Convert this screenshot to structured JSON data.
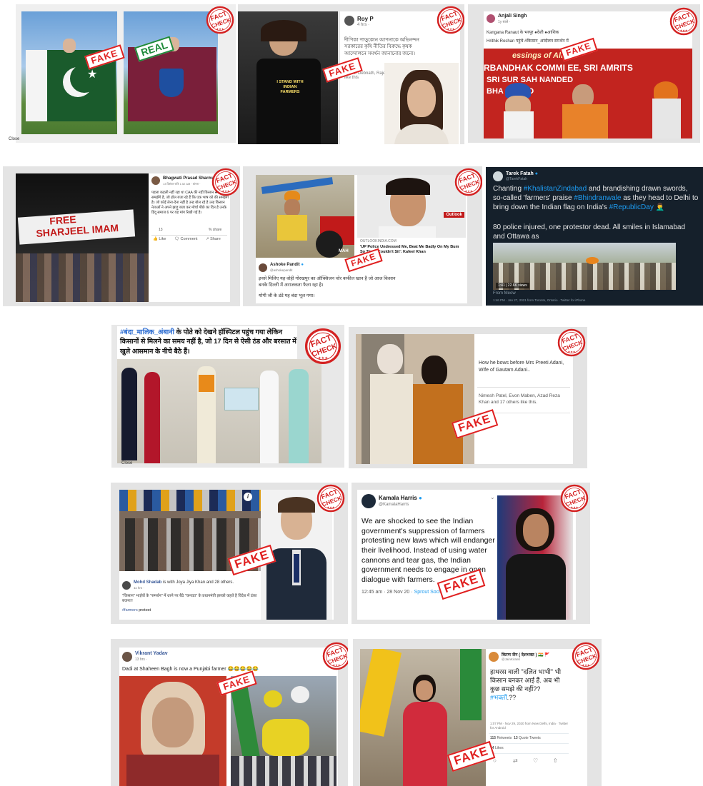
{
  "stamps": {
    "fake": "FAKE",
    "real": "REAL",
    "fact": "FACT",
    "check": "CHECK"
  },
  "row1": {
    "c1": {
      "close": "Close"
    },
    "c2": {
      "name": "Roy P",
      "time": "4 hrs · ",
      "text": "দীপিকা পাড়ুকোন আপনাকে অভিনন্দন সরকারের কৃষি নীতির বিরুদ্ধে কৃষক আন্দোলনে সমর্থন জানানোর জন্যে।",
      "likes": "Sudhir Debnath, Rajeshwar … and 3 others like this",
      "likes2": "Lal and 3 others like this",
      "tshirt": "I STAND WITH INDIAN FARMERS"
    },
    "c3": {
      "name": "Anjali Singh",
      "time": "1y बाले · ",
      "l1": "Kangana Ranaut के भरपूर ●देशी ●आशिक",
      "l2": "Hrithik Roshan पहुंचे #किसान_आंदोलन समर्थन में",
      "banner": "essings of Almi",
      "banner2": "RBANDHAK COMMI EE, SRI AMRITS",
      "banner3": "SRI SUR SAH NANDED",
      "banner4": "BHA (RE.), D"
    }
  },
  "row2": {
    "c1": {
      "name": "Bhagwati Prasad Sharma",
      "time": "13 दिसंबर रात्रि 1:52 AM · बांग्ला · ",
      "text": "पहला कहली नहीं रहा था CAA की नहीं किसान ● की समझेंगे है, जो ढोल बजा रहे हैं कि एक भाष को की समझेंगे है। जो कोई लेना-देना नहीं है उन्ह बोल रहे है उन्ह किसान नेताओं ने अपने झाड़ू बजा कर मोर्चा पीछे का दिन है उनके हिंदू समाज 6 पर यह मांग रिखी गई है।",
      "count": "13",
      "shares": "% share",
      "like": "Like",
      "comment": "Comment",
      "share": "Share",
      "banner1": "FREE",
      "banner2": "SHARJEEL IMAM"
    },
    "c2": {
      "source": "OUTLOOKINDIA.COM",
      "headline": "'UP Police Undressed Me, Beat Me Badly On My Bum So That I Couldn't Sit': Kafeel Khan",
      "logo": "Outlook",
      "name": "Ashoke Pandit",
      "handle": "@ashokepandit",
      "text": "इनसे मिलिए यह वोही गोरखपुर का ऑक्सिजन चोर कफील खान है जो आज किसान बनके दिल्ली में अराजकता फैला रहा है।",
      "text2": "योगी जी के डंडे यह बंदा भूल गया।",
      "tractor": "MAH"
    },
    "c3": {
      "name": "Tarek Fatah",
      "handle": "@TarekFatah",
      "t1": "Chanting ",
      "h1": "#KhalistanZindabad",
      "t2": " and brandishing drawn swords, so-called 'farmers' praise ",
      "h2": "#Bhindranwale",
      "t3": " as they head to Delhi to bring down the Indian flag on India's ",
      "h3": "#RepublicDay",
      "t4": " 🤦‍♂️",
      "p2": "80 police injured, one protestor dead. All smiles in Islamabad and Ottawa as",
      "views": "1:41 | 22.6K views",
      "from": "From Meow",
      "meta": "1:46 PM · Jan 27, 2021 from Toronto, Ontario · Twitter for iPhone"
    }
  },
  "row3": {
    "c1": {
      "hash": "#बंदा_मालिक_अंबानी",
      "text": " के पोते को देखने हॉस्पिटल पहुंच गया लेकिन किसानों से मिलने का समय नहीं है, जो 17 दिन से ऐसी ठंड और बरसात में खुले आसमान के नीचे बैठे हैं।",
      "close": "Close"
    },
    "c2": {
      "caption": "How he bows before Mrs Preeti Adani, Wife of Gautam Adani..",
      "likes": "Nimesh Patel, Evon Maben, Azad Reza Khan and 17 others like this."
    }
  },
  "row4": {
    "c1": {
      "name": "Mohd Shadab",
      "with": " is with Joya Jiya Khan and 28 others.",
      "time": "11 hrs · ",
      "text": "\"किसान\" भाईयों के \"समर्थन\" में धरने पर बैठे \"कनाडा\" के प्रधानमंत्री इसको कहते है विदेश में डंका बजना!!",
      "tag": "#farmers",
      "tag2": " protest",
      "info": "i"
    },
    "c2": {
      "name": "Kamala Harris",
      "handle": "@KamalaHarris",
      "text": "We are shocked to see the Indian government's suppression of farmers protesting new laws which will endanger their livelihood. Instead of using water cannons and tear gas, the Indian government needs to engage in open dialogue with farmers.",
      "meta": "12:45 am · 28 Nov 20 · ",
      "source": "Sprout Social"
    }
  },
  "row5": {
    "c1": {
      "name": "Vikrant Yadav",
      "time": "13 hrs · ",
      "text": "Dadi at Shaheen Bagh is now a Punjabi farmer 😂😂😂😂😂"
    },
    "c2": {
      "name": "किरण जैन ( देशभक्त ) 🇮🇳 🚩",
      "handle": "@JainKiran6",
      "text": "हाथरस वाली \"दलित भाभी\" भी किसान बनकर आई हैं. अब भी कुछ समझे की नहीं??",
      "hash": "#भक्तों",
      "hash2": ".??",
      "meta": "1:07 PM · Nov 29, 2020 from New Delhi, India · Twitter for Android",
      "retweets_n": "115",
      "retweets": " Retweets",
      "quotes_n": "13",
      "quotes": " Quote Tweets",
      "likes_n": "24",
      "likes": " Likes"
    }
  },
  "colors": {
    "fake_red": "#e02020",
    "real_green": "#1f8a3a",
    "twitter_blue": "#1d9bf0",
    "dark_bg": "#15202b"
  }
}
